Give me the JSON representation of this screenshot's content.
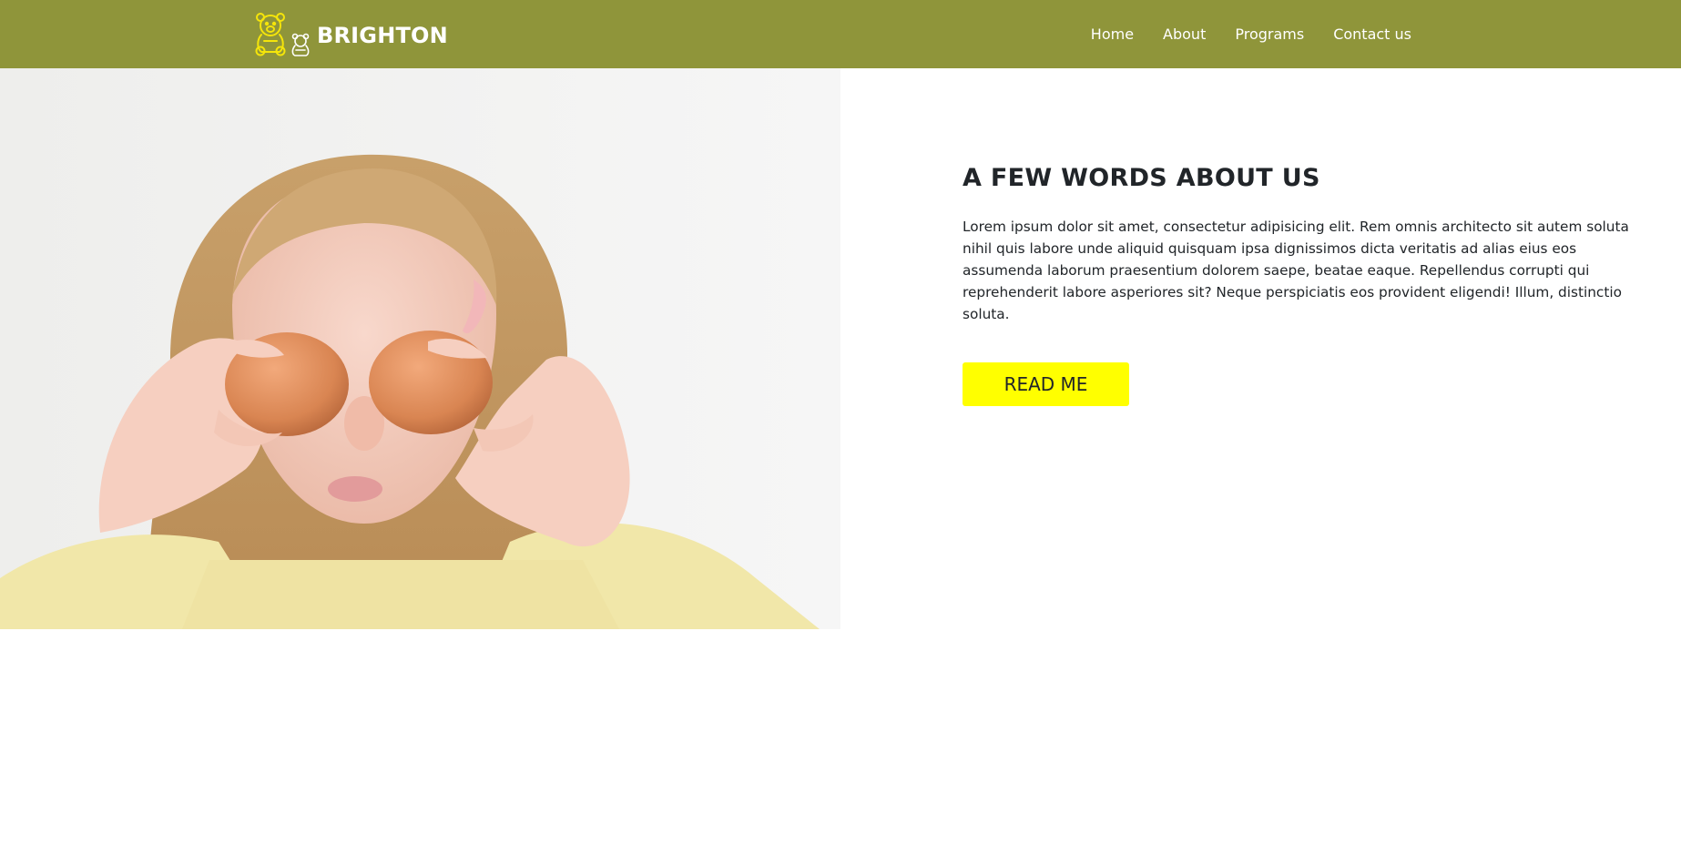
{
  "brand": {
    "name": "BRIGHTON",
    "logo_icon": "teddy-bears-logo-icon"
  },
  "nav": {
    "items": [
      {
        "label": "Home"
      },
      {
        "label": "About"
      },
      {
        "label": "Programs"
      },
      {
        "label": "Contact us"
      }
    ]
  },
  "about": {
    "title": "A FEW WORDS ABOUT US",
    "text": "Lorem ipsum dolor sit amet, consectetur adipisicing elit. Rem omnis architecto sit autem soluta nihil quis labore unde aliquid quisquam ipsa dignissimos dicta veritatis ad alias eius eos assumenda laborum praesentium dolorem saepe, beatae eaque. Repellendus corrupti qui reprehenderit labore asperiores sit? Neque perspiciatis eos provident eligendi! Illum, distinctio soluta.",
    "button_label": "READ ME"
  },
  "colors": {
    "navbar": "#8f953a",
    "button": "#ffff00",
    "logo": "#f5e50a",
    "text": "#212529"
  }
}
